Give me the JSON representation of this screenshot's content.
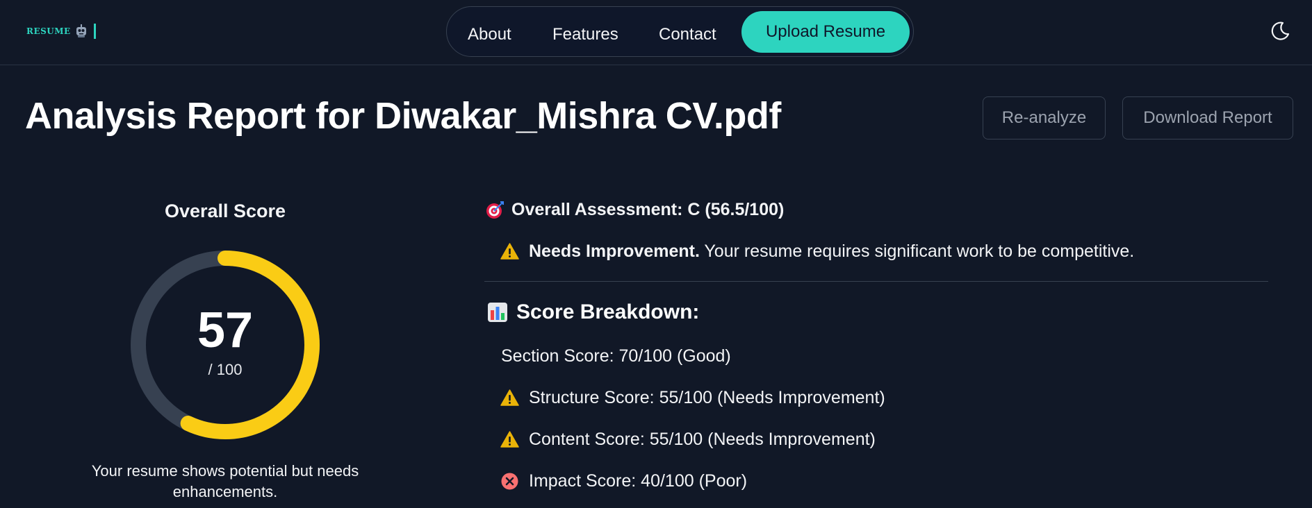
{
  "header": {
    "logo_text": "RESUME",
    "nav": {
      "about": "About",
      "features": "Features",
      "contact": "Contact",
      "upload": "Upload Resume"
    },
    "theme_icon": "moon-icon"
  },
  "title_row": {
    "title": "Analysis Report for Diwakar_Mishra CV.pdf",
    "reanalyze": "Re-analyze",
    "download": "Download Report"
  },
  "score_panel": {
    "heading": "Overall Score",
    "value": "57",
    "max_label": "/ 100",
    "fill_fraction": 0.57,
    "caption": "Your resume shows potential but needs enhancements."
  },
  "report": {
    "assessment": "Overall Assessment: C (56.5/100)",
    "status_label": "Needs Improvement.",
    "status_text": " Your resume requires significant work to be competitive.",
    "breakdown_heading": "Score Breakdown:",
    "items": [
      {
        "text": "Section Score: 70/100 (Good)",
        "icon": "none"
      },
      {
        "text": "Structure Score: 55/100 (Needs Improvement)",
        "icon": "warning-icon"
      },
      {
        "text": "Content Score: 55/100 (Needs Improvement)",
        "icon": "warning-icon"
      },
      {
        "text": "Impact Score: 40/100 (Poor)",
        "icon": "error-icon"
      }
    ]
  },
  "colors": {
    "background": "#111827",
    "accent": "#2dd4bf",
    "gauge_fill": "#facc15",
    "gauge_track": "#374151",
    "warning": "#eab308",
    "error": "#f87171"
  }
}
